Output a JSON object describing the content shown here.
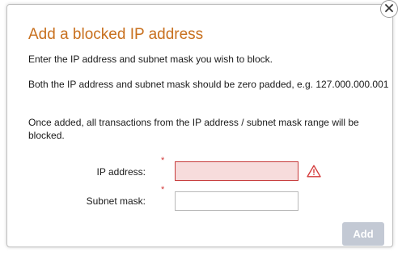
{
  "dialog": {
    "title": "Add a blocked IP address",
    "paragraphs": [
      "Enter the IP address and subnet mask you wish to block.",
      "Both the IP address and subnet mask should be zero padded, e.g. 127.000.000.001",
      "Once added, all transactions from the IP address / subnet mask range will be blocked."
    ],
    "close_icon": "close-icon"
  },
  "form": {
    "ip_label": "IP address:",
    "ip_value": "",
    "mask_label": "Subnet mask:",
    "mask_value": "",
    "required_marker": "*",
    "ip_state": "error",
    "warning_icon": "warning-icon"
  },
  "actions": {
    "add_label": "Add",
    "add_enabled": false
  },
  "colors": {
    "title": "#c8701e",
    "required": "#d33a3a",
    "error_bg": "#f7dcdc",
    "error_border": "#c73b3b",
    "button_disabled": "#c3c9d4"
  }
}
